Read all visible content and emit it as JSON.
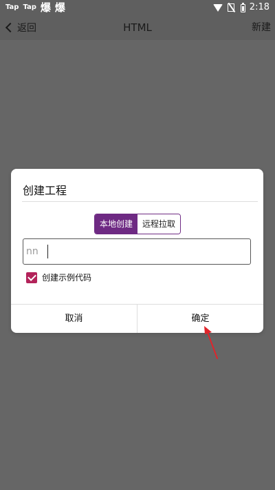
{
  "status_bar": {
    "left_items": [
      "Tap",
      "Tap",
      "爆",
      "爆"
    ],
    "time": "2:18",
    "icons": [
      "wifi-icon",
      "no-sim-icon",
      "battery-icon"
    ]
  },
  "toolbar": {
    "back_label": "返回",
    "title": "HTML",
    "new_label": "新建"
  },
  "dialog": {
    "title": "创建工程",
    "tabs": [
      {
        "label": "本地创建",
        "active": true
      },
      {
        "label": "远程拉取",
        "active": false
      }
    ],
    "name_input": {
      "value": "nn"
    },
    "checkbox": {
      "label": "创建示例代码",
      "checked": true
    },
    "cancel_label": "取消",
    "ok_label": "确定"
  },
  "colors": {
    "accent": "#6e2a83",
    "checkbox": "#b3235a",
    "annotation_arrow": "#e0252b",
    "backdrop": "#666666"
  }
}
